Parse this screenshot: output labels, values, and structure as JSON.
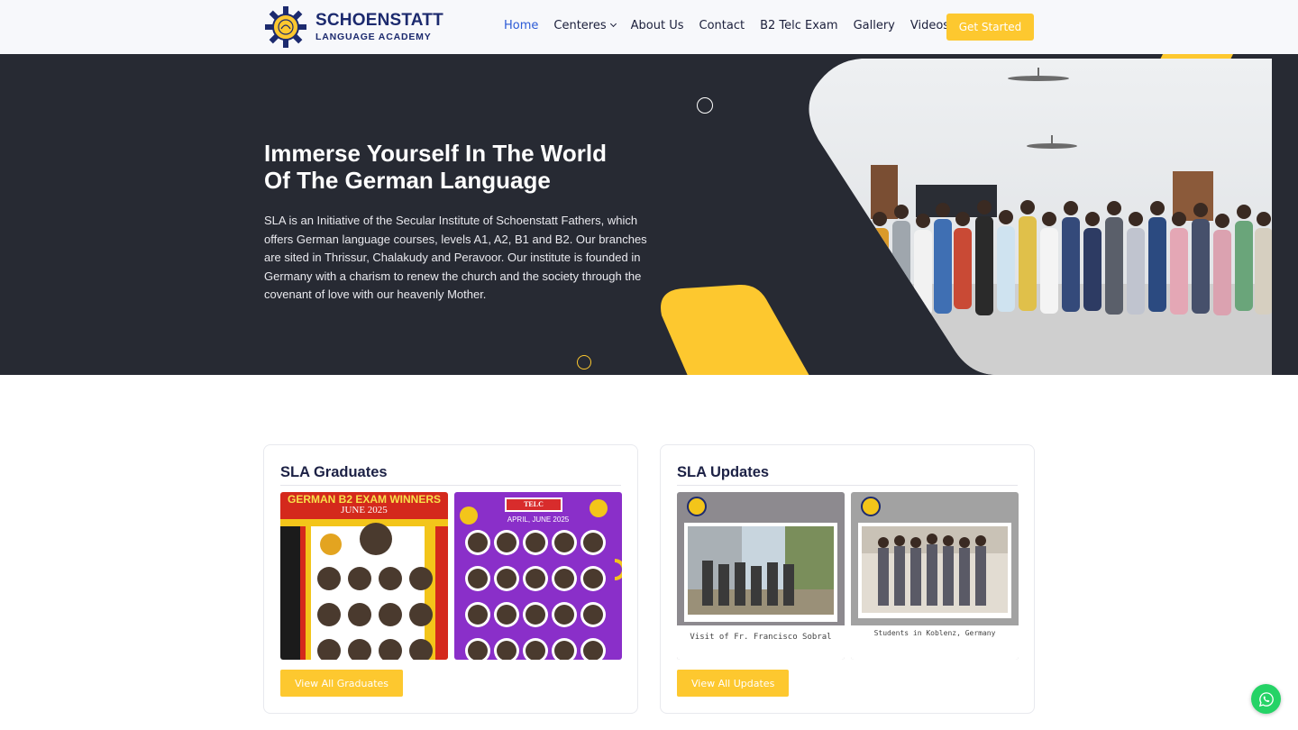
{
  "brand": {
    "title": "SCHOENSTATT",
    "subtitle": "LANGUAGE ACADEMY"
  },
  "nav": {
    "items": [
      {
        "label": "Home",
        "active": true
      },
      {
        "label": "Centeres",
        "dropdown": true
      },
      {
        "label": "About Us"
      },
      {
        "label": "Contact"
      },
      {
        "label": "B2 Telc Exam"
      },
      {
        "label": "Gallery"
      },
      {
        "label": "Videos"
      }
    ],
    "cta_label": "Get Started"
  },
  "hero": {
    "title_line1": "Immerse Yourself In The World",
    "title_line2": "Of The German Language",
    "description": "SLA is an Initiative of the Secular Institute of Schoenstatt Fathers, which offers German language courses, levels A1, A2, B1 and B2. Our branches are sited in Thrissur, Chalakudy and Peravoor. Our institute is founded in Germany with a charism to renew the church and the society through the covenant of love with our heavenly Mother."
  },
  "graduates": {
    "title": "SLA Graduates",
    "poster1_headline": "GERMAN B2 EXAM WINNERS",
    "poster1_date": "JUNE 2025",
    "poster2_badge": "TELC",
    "poster2_date": "APRIL, JUNE 2025",
    "button_label": "View All Graduates"
  },
  "updates": {
    "title": "SLA Updates",
    "update1_caption": "Visit of Fr. Francisco Sobral",
    "update2_caption": "Students in Koblenz, Germany",
    "button_label": "View All Updates"
  },
  "colors": {
    "accent": "#fdc82f",
    "hero_bg": "#272a33",
    "nav_active": "#2c5bd6",
    "brand_navy": "#1c2a6e",
    "whatsapp": "#25d366"
  },
  "icons": {
    "chat": "whatsapp-icon",
    "dropdown": "chevron-down-icon"
  }
}
